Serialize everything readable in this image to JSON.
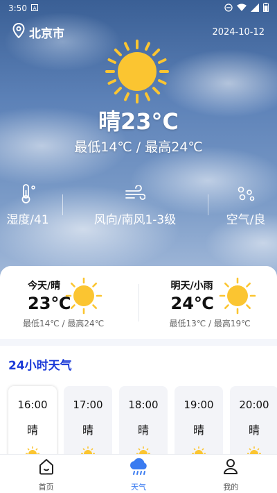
{
  "status_bar": {
    "time": "3:50",
    "colors": {
      "text": "#ffffff"
    }
  },
  "header": {
    "city": "北京市",
    "date": "2024-10-12"
  },
  "current": {
    "condition_temp": "晴23°C",
    "range": "最低14℃  /  最高24℃"
  },
  "metrics": [
    {
      "icon": "thermometer-icon",
      "label": "湿度/41"
    },
    {
      "icon": "wind-icon",
      "label": "风向/南风1-3级"
    },
    {
      "icon": "air-drops-icon",
      "label": "空气/良"
    }
  ],
  "forecast": [
    {
      "title": "今天/晴",
      "temp": "23℃",
      "range": "最低14℃ / 最高24℃"
    },
    {
      "title": "明天/小雨",
      "temp": "24℃",
      "range": "最低13℃ / 最高19℃"
    }
  ],
  "hourly": {
    "title": "24小时天气",
    "items": [
      {
        "time": "16:00",
        "cond": "晴"
      },
      {
        "time": "17:00",
        "cond": "晴"
      },
      {
        "time": "18:00",
        "cond": "晴"
      },
      {
        "time": "19:00",
        "cond": "晴"
      },
      {
        "time": "20:00",
        "cond": "晴"
      }
    ]
  },
  "tabs": [
    {
      "label": "首页",
      "icon": "home-icon"
    },
    {
      "label": "天气",
      "icon": "rain-cloud-icon",
      "active": true
    },
    {
      "label": "我的",
      "icon": "user-icon"
    }
  ],
  "colors": {
    "accent": "#3a7bf0",
    "title_blue": "#1b3ad8",
    "sun": "#fbc531"
  }
}
